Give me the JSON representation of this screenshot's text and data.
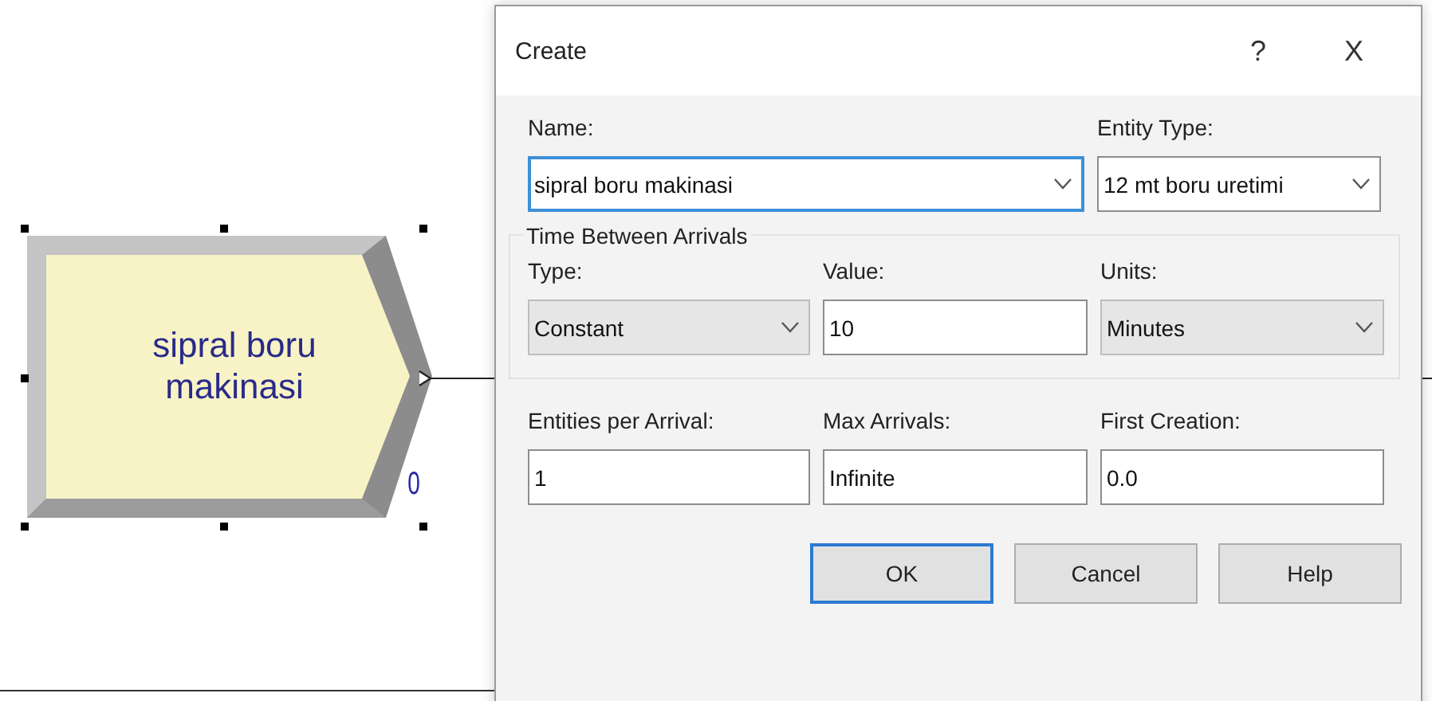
{
  "module": {
    "label": "sipral boru makinasi",
    "count": "0",
    "selected": true
  },
  "dialog": {
    "title": "Create",
    "help": "?",
    "close": "X",
    "top_fields": [
      {
        "kind": "combo",
        "label": "Name:",
        "value": "sipral boru makinasi",
        "focused": true,
        "editable": true
      },
      {
        "kind": "combo",
        "label": "Entity Type:",
        "value": "12 mt boru uretimi",
        "focused": false,
        "editable": true
      }
    ],
    "group": {
      "title": "Time Between Arrivals",
      "fields": [
        {
          "kind": "combo",
          "label": "Type:",
          "value": "Constant",
          "focused": false,
          "editable": false
        },
        {
          "kind": "text",
          "label": "Value:",
          "value": "10",
          "focused": false
        },
        {
          "kind": "combo",
          "label": "Units:",
          "value": "Minutes",
          "focused": false,
          "editable": false
        }
      ]
    },
    "fields": [
      {
        "kind": "text",
        "label": "Entities per Arrival:",
        "value": "1",
        "focused": false
      },
      {
        "kind": "text",
        "label": "Max Arrivals:",
        "value": "Infinite",
        "focused": false
      },
      {
        "kind": "text",
        "label": "First Creation:",
        "value": "0.0",
        "focused": false
      }
    ],
    "buttons": [
      {
        "label": "OK",
        "default": true
      },
      {
        "label": "Cancel",
        "default": false
      },
      {
        "label": "Help",
        "default": false
      }
    ]
  }
}
